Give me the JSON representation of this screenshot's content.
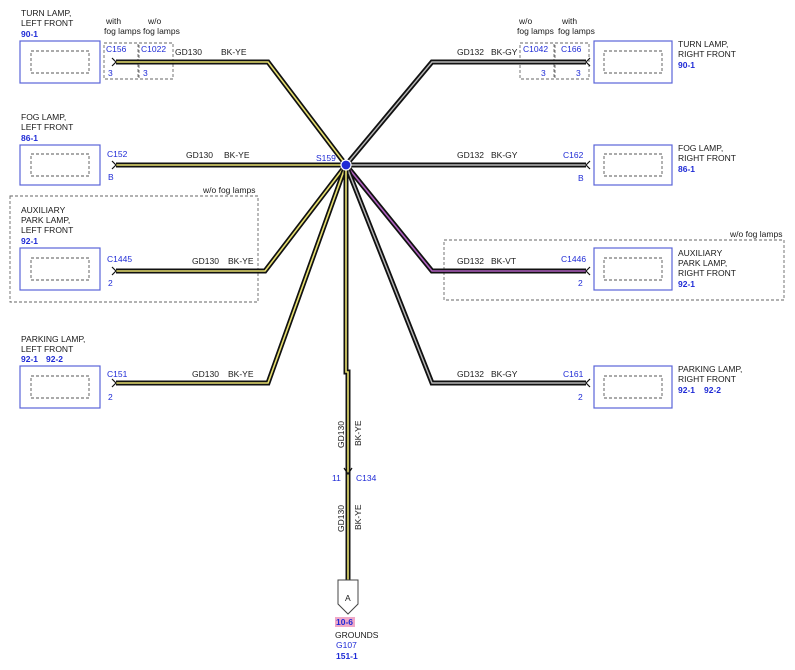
{
  "colors": {
    "wire_black": "#111111",
    "stripe_yellow": "#e8e070",
    "stripe_gray": "#b8b8b8",
    "stripe_violet": "#b060c0",
    "connector_blue": "#1f2bd6",
    "component_border": "#5a64d8",
    "splice_fill": "#1f2bd6",
    "ref_highlight": "#f0a8c8"
  },
  "components": {
    "turn_lamp_lf": {
      "name_line1": "TURN LAMP,",
      "name_line2": "LEFT FRONT",
      "ref": "90-1"
    },
    "fog_lamp_lf": {
      "name_line1": "FOG LAMP,",
      "name_line2": "LEFT FRONT",
      "ref": "86-1"
    },
    "aux_park_lf": {
      "name_line1": "AUXILIARY",
      "name_line2": "PARK LAMP,",
      "name_line3": "LEFT FRONT",
      "ref": "92-1"
    },
    "parking_lamp_lf": {
      "name_line1": "PARKING LAMP,",
      "name_line2": "LEFT FRONT",
      "ref1": "92-1",
      "ref2": "92-2"
    },
    "turn_lamp_rf": {
      "name_line1": "TURN LAMP,",
      "name_line2": "RIGHT FRONT",
      "ref": "90-1"
    },
    "fog_lamp_rf": {
      "name_line1": "FOG LAMP,",
      "name_line2": "RIGHT FRONT",
      "ref": "86-1"
    },
    "aux_park_rf": {
      "name_line1": "AUXILIARY",
      "name_line2": "PARK LAMP,",
      "name_line3": "RIGHT FRONT",
      "ref": "92-1"
    },
    "parking_lamp_rf": {
      "name_line1": "PARKING LAMP,",
      "name_line2": "RIGHT FRONT",
      "ref1": "92-1",
      "ref2": "92-2"
    }
  },
  "option_labels": {
    "with": "with",
    "wo": "w/o",
    "fog_lamps": "fog lamps",
    "wo_fog_lamps": "w/o fog lamps"
  },
  "connectors": {
    "c156": {
      "id": "C156",
      "pin": "3"
    },
    "c1022": {
      "id": "C1022",
      "pin": "3"
    },
    "c152": {
      "id": "C152",
      "pin": "B"
    },
    "c1445": {
      "id": "C1445",
      "pin": "2"
    },
    "c151": {
      "id": "C151",
      "pin": "2"
    },
    "c1042": {
      "id": "C1042",
      "pin": "3"
    },
    "c166": {
      "id": "C166",
      "pin": "3"
    },
    "c162": {
      "id": "C162",
      "pin": "B"
    },
    "c1446": {
      "id": "C1446",
      "pin": "2"
    },
    "c161": {
      "id": "C161",
      "pin": "2"
    },
    "c134": {
      "id": "C134",
      "pin": "11"
    }
  },
  "splice": {
    "id": "S159"
  },
  "wires": {
    "gd130": "GD130",
    "gd132": "GD132",
    "bk_ye": "BK-YE",
    "bk_gy": "BK-GY",
    "bk_vt": "BK-VT"
  },
  "ground": {
    "label": "A",
    "page_ref": "10-6",
    "title": "GROUNDS",
    "id": "G107",
    "ref": "151-1"
  }
}
